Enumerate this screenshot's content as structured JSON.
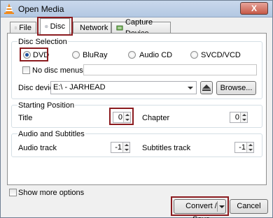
{
  "window": {
    "title": "Open Media",
    "close_label": "X"
  },
  "tabs": [
    {
      "label": "File",
      "icon": "file-icon"
    },
    {
      "label": "Disc",
      "icon": "disc-icon"
    },
    {
      "label": "Network",
      "icon": "network-icon"
    },
    {
      "label": "Capture Device",
      "icon": "capture-device-icon"
    }
  ],
  "active_tab": "Disc",
  "disc_selection": {
    "title": "Disc Selection",
    "options": [
      "DVD",
      "BluRay",
      "Audio CD",
      "SVCD/VCD"
    ],
    "selected": "DVD",
    "no_disc_menus_label": "No disc menus",
    "device_label": "Disc device",
    "device_value": "E:\\ - JARHEAD",
    "browse_label": "Browse..."
  },
  "starting_position": {
    "title": "Starting Position",
    "title_label": "Title",
    "title_value": "0",
    "chapter_label": "Chapter",
    "chapter_value": "0"
  },
  "audio_subtitles": {
    "title": "Audio and Subtitles",
    "audio_label": "Audio track",
    "audio_value": "-1",
    "subtitles_label": "Subtitles track",
    "subtitles_value": "-1"
  },
  "footer": {
    "show_more_label": "Show more options",
    "convert_label": "Convert / Save",
    "cancel_label": "Cancel"
  },
  "colors": {
    "highlight": "#8b1b1f",
    "radio_selected": "#1d4f9c"
  }
}
